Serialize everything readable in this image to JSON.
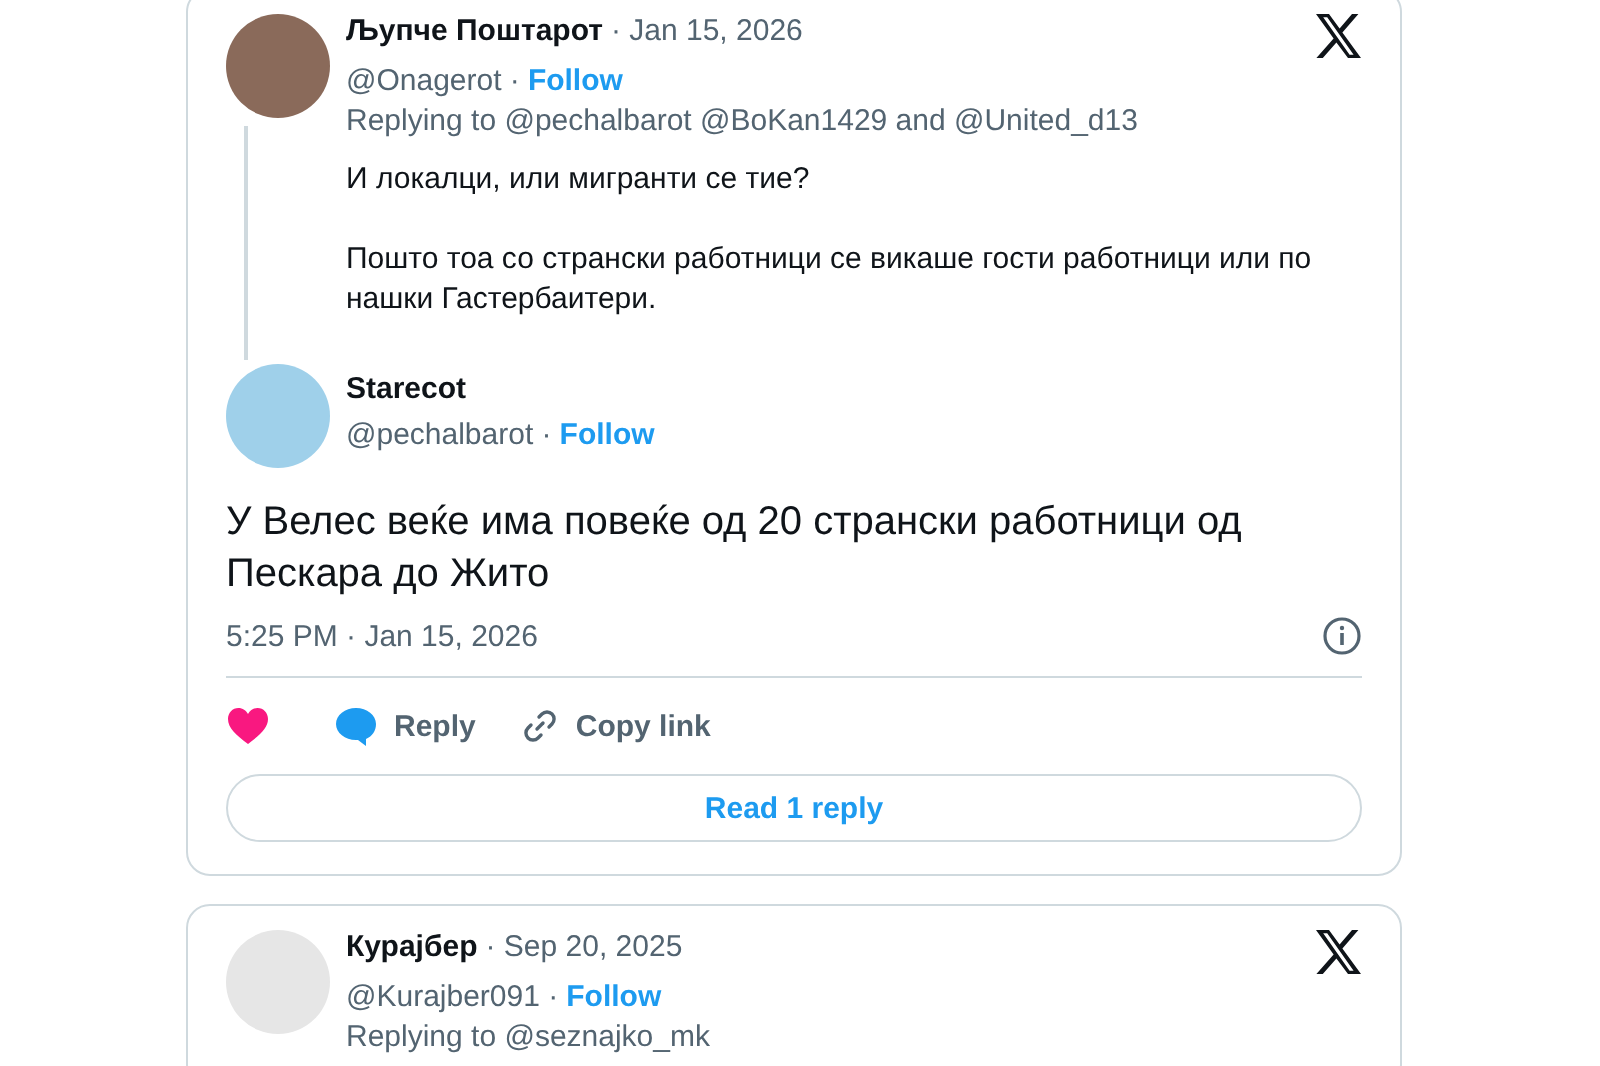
{
  "cards": [
    {
      "kind": "thread",
      "parent": {
        "name": "Љупче Поштарот",
        "date": "· Jan 15, 2026",
        "handle": "@Onagerot ·",
        "follow": "Follow",
        "replying": "Replying to @pechalbarot @BoKan1429 and @United_d13",
        "paragraphs": [
          "И локалци, или мигранти се тие?",
          "Пошто тоа со странски работници се викаше гости работници или по нашки Гастербаитери."
        ]
      },
      "main": {
        "name": "Starecot",
        "handle": "@pechalbarot ·",
        "follow": "Follow",
        "text": "У Велес веќе има повеќе од 20 странски работници од Пескара до Жито",
        "time": "5:25 PM · Jan 15, 2026",
        "actions": [
          {
            "kind": "like"
          },
          {
            "kind": "reply",
            "label": "Reply"
          },
          {
            "kind": "copy",
            "label": "Copy link"
          }
        ],
        "more": "Read 1 reply"
      }
    },
    {
      "kind": "single",
      "parent": {
        "name": "Курајбер",
        "date": "· Sep 20, 2025",
        "handle": "@Kurajber091 ·",
        "follow": "Follow",
        "replying": "Replying to @seznajko_mk"
      }
    }
  ]
}
